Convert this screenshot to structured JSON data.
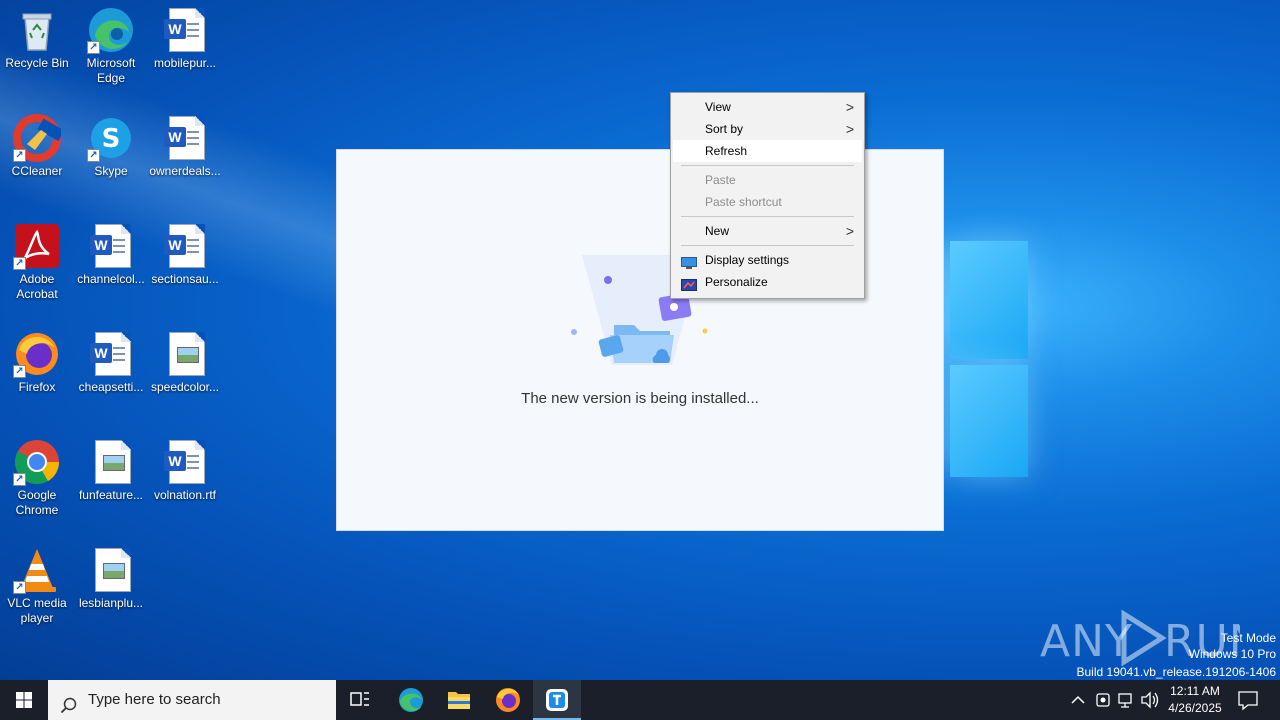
{
  "desktop": {
    "icons": [
      {
        "label": "Recycle Bin"
      },
      {
        "label": "Microsoft Edge"
      },
      {
        "label": "mobilepur..."
      },
      {
        "label": "CCleaner"
      },
      {
        "label": "Skype"
      },
      {
        "label": "ownerdeals..."
      },
      {
        "label": "Adobe Acrobat"
      },
      {
        "label": "channelcol..."
      },
      {
        "label": "sectionsau..."
      },
      {
        "label": "Firefox"
      },
      {
        "label": "cheapsetti..."
      },
      {
        "label": "speedcolor..."
      },
      {
        "label": "Google Chrome"
      },
      {
        "label": "funfeature..."
      },
      {
        "label": "volnation.rtf"
      },
      {
        "label": "VLC media player"
      },
      {
        "label": "lesbianplu..."
      }
    ]
  },
  "installer": {
    "message": "The new version is being installed..."
  },
  "context_menu": {
    "items": [
      {
        "label": "View",
        "arrow": ">"
      },
      {
        "label": "Sort by",
        "arrow": ">"
      },
      {
        "label": "Refresh"
      },
      {
        "label": "Paste"
      },
      {
        "label": "Paste shortcut"
      },
      {
        "label": "New",
        "arrow": ">"
      },
      {
        "label": "Display settings"
      },
      {
        "label": "Personalize"
      }
    ]
  },
  "watermark": {
    "brand": "ANY RUN",
    "test_mode": "Test Mode",
    "edition": "Windows 10 Pro",
    "build": "Build 19041.vb_release.191206-1406"
  },
  "taskbar": {
    "search_placeholder": "Type here to search",
    "clock_time": "12:11 AM",
    "clock_date": "4/26/2025"
  },
  "colors": {
    "accent": "#0a6cd3",
    "taskbar": "#1a1f2a",
    "menu_bg": "#f2f2f2"
  }
}
